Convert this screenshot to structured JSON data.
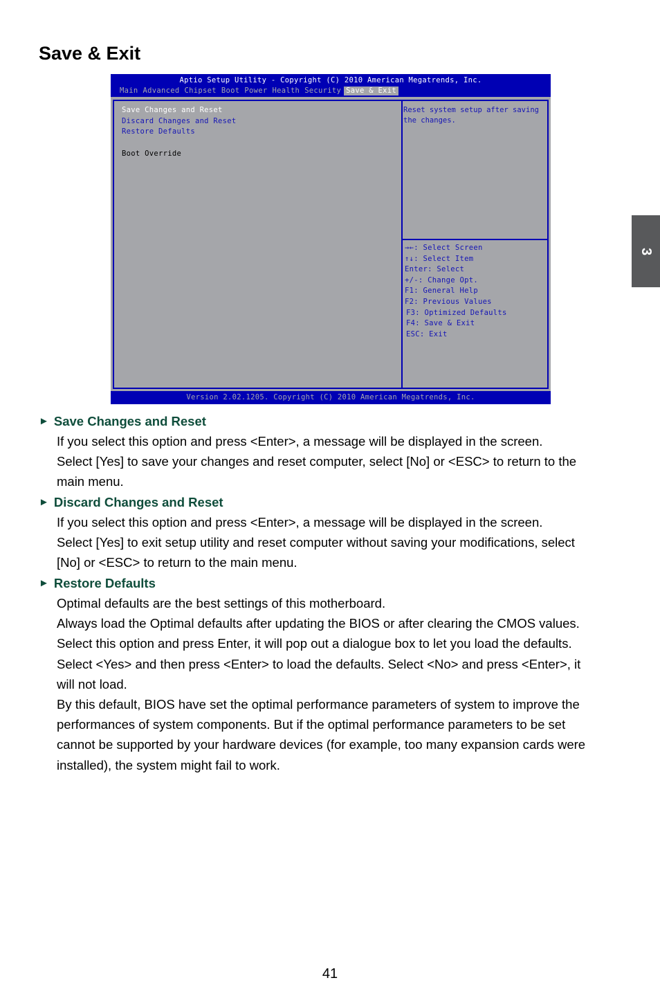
{
  "page": {
    "title": "Save & Exit",
    "chapter_tab": "3",
    "page_number": "41"
  },
  "bios": {
    "title": "Aptio Setup Utility - Copyright (C) 2010 American Megatrends, Inc.",
    "tabs": [
      {
        "label": "Main",
        "active": false
      },
      {
        "label": "Advanced",
        "active": false
      },
      {
        "label": "Chipset",
        "active": false
      },
      {
        "label": "Boot",
        "active": false
      },
      {
        "label": "Power",
        "active": false
      },
      {
        "label": "Health",
        "active": false
      },
      {
        "label": "Security",
        "active": false
      },
      {
        "label": "Save & Exit",
        "active": true
      }
    ],
    "menu": [
      {
        "label": "Save Changes and Reset",
        "state": "selected"
      },
      {
        "label": "Discard Changes and Reset",
        "state": "option"
      },
      {
        "label": "Restore Defaults",
        "state": "option"
      },
      {
        "label": "Boot Override",
        "state": "static"
      }
    ],
    "help_text": "Reset system setup after saving the changes.",
    "keys": [
      "→←: Select Screen",
      "↑↓: Select Item",
      "Enter: Select",
      "+/-: Change Opt.",
      "F1: General Help",
      "F2: Previous Values",
      "F3: Optimized Defaults",
      "F4: Save & Exit",
      "ESC: Exit"
    ],
    "footer": "Version 2.02.1205. Copyright (C) 2010 American Megatrends, Inc.",
    "colors": {
      "header": "#0000b4",
      "panel": "#a5a6aa",
      "text_blue": "#1515b5"
    }
  },
  "sections": [
    {
      "heading": "Save Changes and Reset",
      "lines": [
        "If you select this option and press <Enter>, a message will be displayed in the screen.",
        "Select [Yes] to save your changes and reset computer, select [No] or <ESC> to return to the",
        "main menu."
      ]
    },
    {
      "heading": "Discard Changes and Reset",
      "lines": [
        "If you select this option and press <Enter>,  a message will be displayed in the screen.",
        "Select [Yes] to exit setup utility and reset computer without saving your modifications, select",
        "[No] or <ESC> to return to the main menu."
      ]
    },
    {
      "heading": "Restore Defaults",
      "lines": [
        "Optimal defaults are the best settings of this motherboard.",
        "Always load the Optimal defaults after updating the BIOS or after clearing the CMOS values.",
        "Select this option and press Enter, it will pop out a dialogue box to let you load the defaults.",
        "Select <Yes> and then press <Enter> to load the defaults. Select <No> and press <Enter>, it",
        "will not load.",
        "By this default, BIOS have set the optimal performance parameters of system to improve the",
        "performances of system components. But if the optimal performance parameters to be set",
        "cannot be supported by your hardware devices (for example, too many expansion cards were",
        "installed), the system might fail to work."
      ]
    }
  ],
  "heading_marker": "►"
}
